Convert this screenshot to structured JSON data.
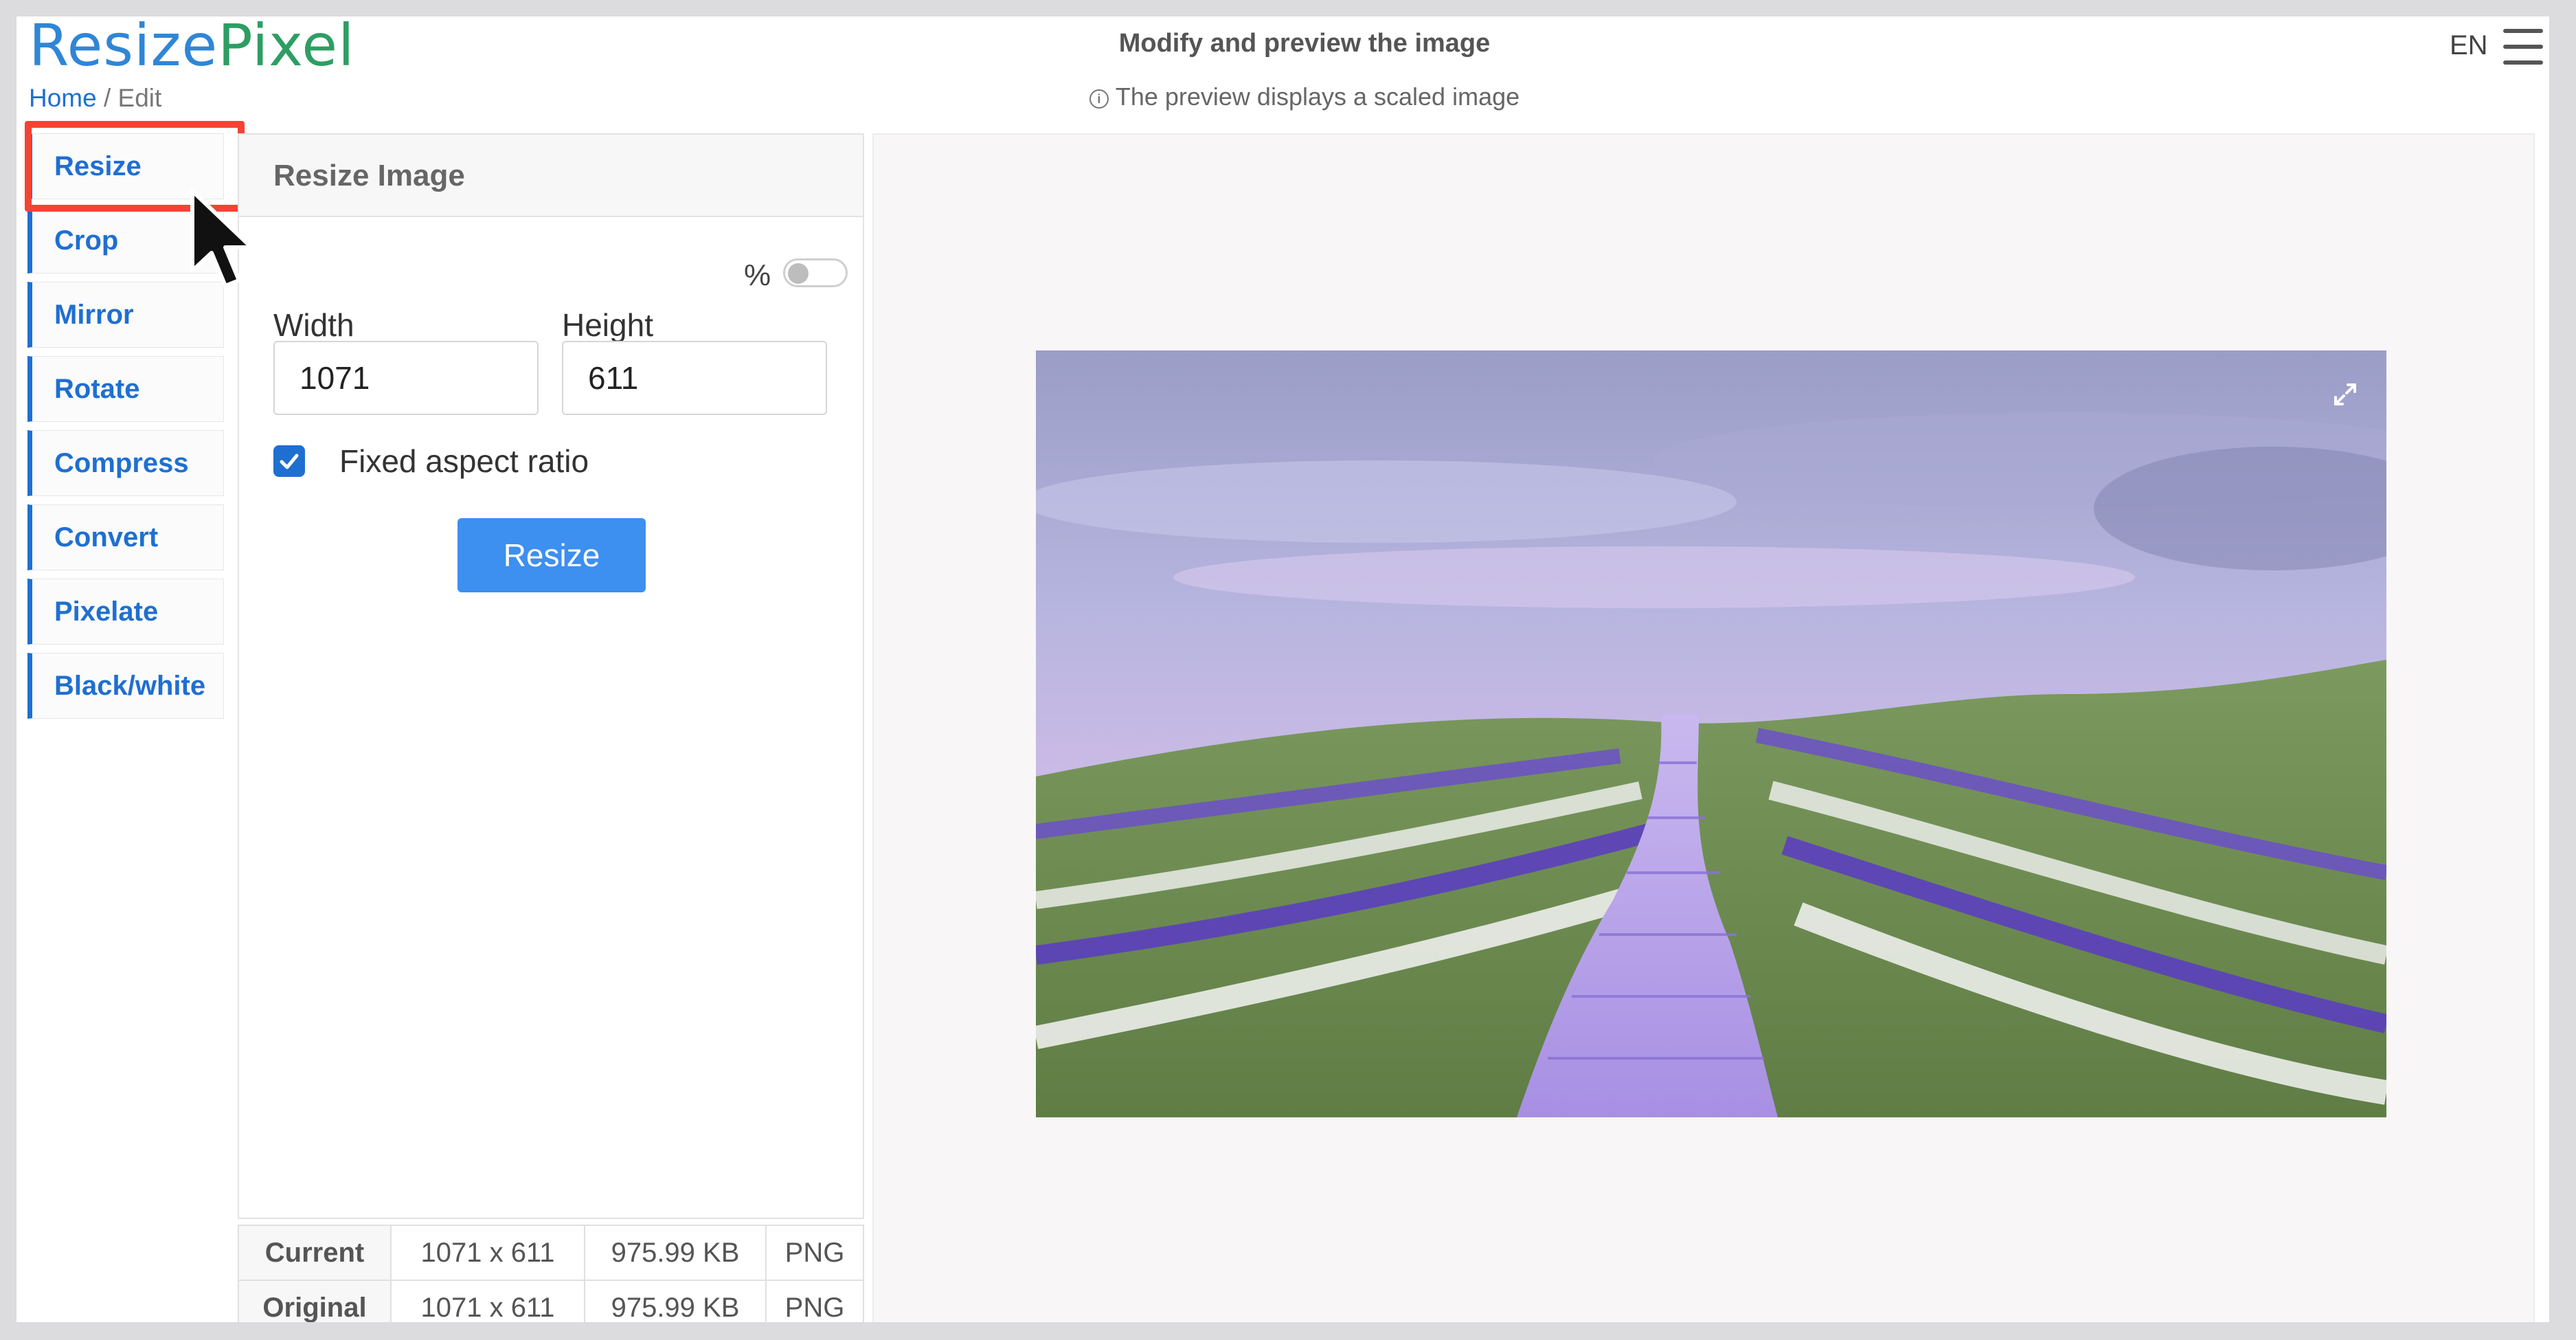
{
  "logo": {
    "part1": "Resize",
    "part2": "Pixel"
  },
  "breadcrumb": {
    "home": "Home",
    "separator": " / ",
    "current": "Edit"
  },
  "header": {
    "title": "Modify and preview the image",
    "subtitle": "The preview displays a scaled image",
    "info_icon": "info-circle-icon",
    "language": "EN",
    "menu_icon": "hamburger-menu-icon"
  },
  "sidebar": {
    "items": [
      {
        "label": "Resize"
      },
      {
        "label": "Crop"
      },
      {
        "label": "Mirror"
      },
      {
        "label": "Rotate"
      },
      {
        "label": "Compress"
      },
      {
        "label": "Convert"
      },
      {
        "label": "Pixelate"
      },
      {
        "label": "Black/white"
      }
    ]
  },
  "panel": {
    "title": "Resize Image",
    "percent_label": "%",
    "percent_toggle_on": false,
    "width_label": "Width",
    "width_value": "1071",
    "height_label": "Height",
    "height_value": "611",
    "aspect_label": "Fixed aspect ratio",
    "aspect_checked": true,
    "button_label": "Resize"
  },
  "info": {
    "rows": [
      {
        "label": "Current",
        "dims": "1071 x 611",
        "size": "975.99 KB",
        "format": "PNG"
      },
      {
        "label": "Original",
        "dims": "1071 x 611",
        "size": "975.99 KB",
        "format": "PNG"
      }
    ]
  },
  "colors": {
    "accent": "#1f6fd1",
    "button": "#3d8ff0",
    "highlight": "#f44336",
    "logo_blue": "#2f86d6",
    "logo_green": "#2d9e63"
  },
  "preview": {
    "expand_icon": "expand-icon"
  }
}
